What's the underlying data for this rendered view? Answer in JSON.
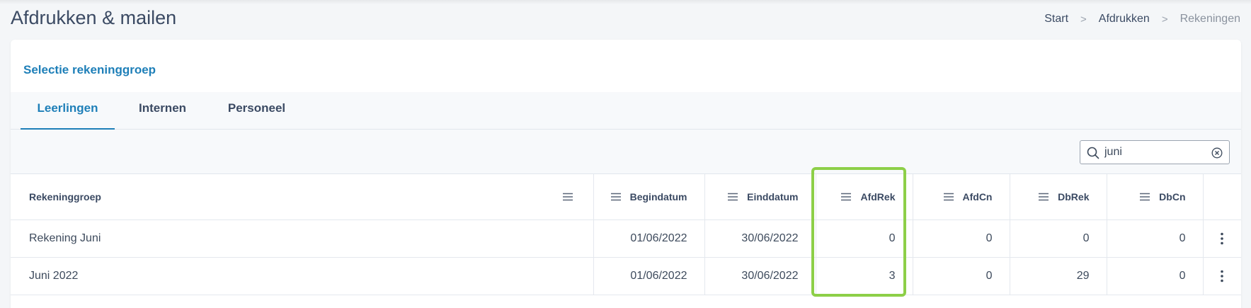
{
  "header": {
    "title": "Afdrukken & mailen",
    "breadcrumb": [
      "Start",
      "Afdrukken",
      "Rekeningen"
    ]
  },
  "card": {
    "title": "Selectie rekeninggroep"
  },
  "tabs": [
    {
      "label": "Leerlingen",
      "active": true
    },
    {
      "label": "Internen",
      "active": false
    },
    {
      "label": "Personeel",
      "active": false
    }
  ],
  "search": {
    "value": "juni",
    "icon": "search-icon",
    "clear_icon": "close-circle-icon"
  },
  "table": {
    "columns": [
      "Rekeninggroep",
      "Begindatum",
      "Einddatum",
      "AfdRek",
      "AfdCn",
      "DbRek",
      "DbCn"
    ],
    "rows": [
      {
        "Rekeninggroep": "Rekening Juni",
        "Begindatum": "01/06/2022",
        "Einddatum": "30/06/2022",
        "AfdRek": "0",
        "AfdCn": "0",
        "DbRek": "0",
        "DbCn": "0"
      },
      {
        "Rekeninggroep": "Juni 2022",
        "Begindatum": "01/06/2022",
        "Einddatum": "30/06/2022",
        "AfdRek": "3",
        "AfdCn": "0",
        "DbRek": "29",
        "DbCn": "0"
      }
    ]
  },
  "colors": {
    "accent": "#1e7fb8",
    "highlight": "#8dcf48"
  }
}
